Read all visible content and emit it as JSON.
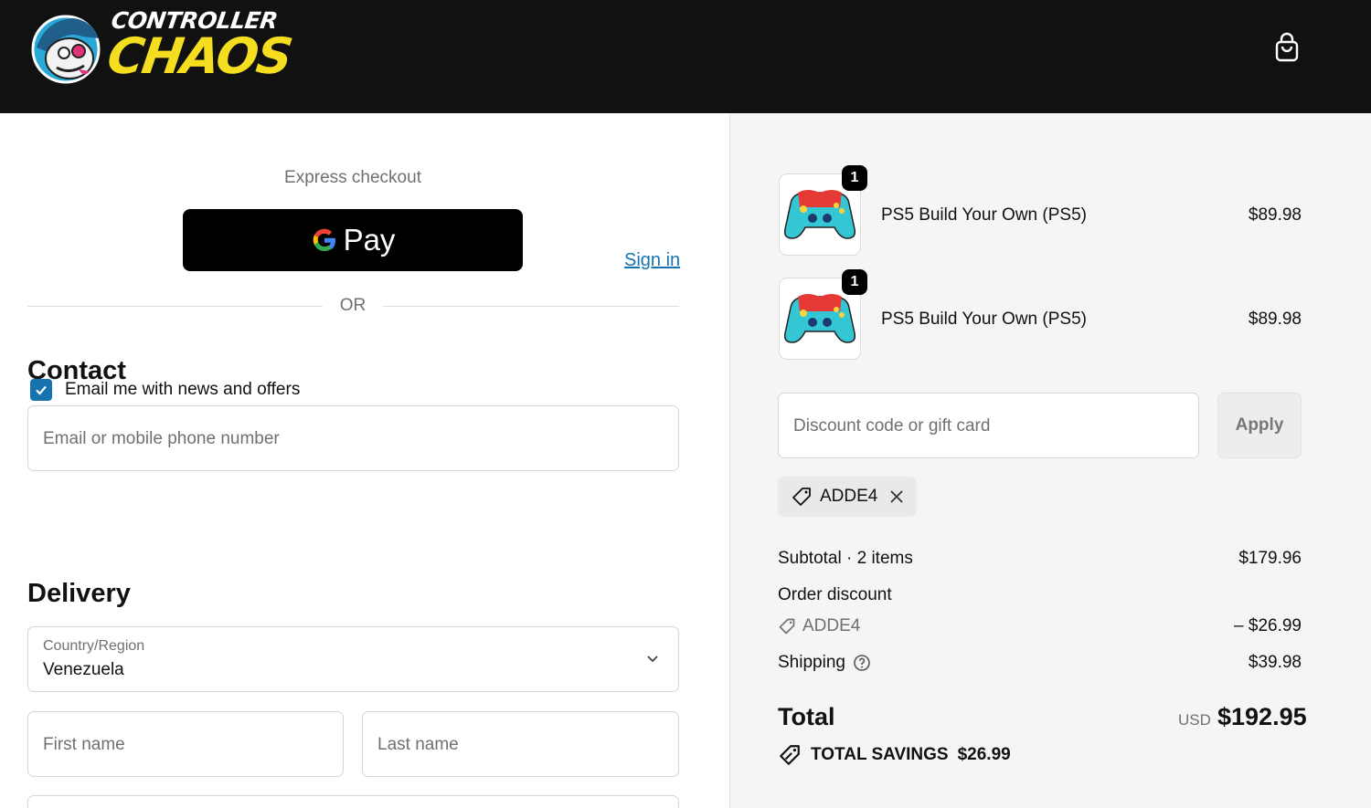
{
  "header": {
    "brand_top": "CONTROLLER",
    "brand_main": "CHAOS",
    "cart_icon": "shopping-bag-icon"
  },
  "express": {
    "label": "Express checkout",
    "gpay_label": "Pay",
    "or": "OR"
  },
  "contact": {
    "title": "Contact",
    "signin": "Sign in",
    "email_placeholder": "Email or mobile phone number",
    "newsletter_label": "Email me with news and offers",
    "newsletter_checked": true
  },
  "delivery": {
    "title": "Delivery",
    "country_label": "Country/Region",
    "country_value": "Venezuela",
    "first_name_placeholder": "First name",
    "last_name_placeholder": "Last name"
  },
  "cart": {
    "items": [
      {
        "name": "PS5 Build Your Own (PS5)",
        "price": "$89.98",
        "qty": "1"
      },
      {
        "name": "PS5 Build Your Own (PS5)",
        "price": "$89.98",
        "qty": "1"
      }
    ],
    "discount_placeholder": "Discount code or gift card",
    "apply_label": "Apply",
    "applied_code": "ADDE4"
  },
  "summary": {
    "subtotal_label": "Subtotal · 2 items",
    "subtotal_value": "$179.96",
    "order_discount_label": "Order discount",
    "discount_code": "ADDE4",
    "discount_value": "– $26.99",
    "shipping_label": "Shipping",
    "shipping_value": "$39.98",
    "total_label": "Total",
    "currency": "USD",
    "total_value": "$192.95",
    "savings_label": "TOTAL SAVINGS",
    "savings_value": "$26.99"
  },
  "colors": {
    "header_bg": "#111111",
    "brand_yellow": "#f5dd1f",
    "link_blue": "#1773b0",
    "checkbox_blue": "#1773b0",
    "summary_bg": "#f5f5f5"
  }
}
